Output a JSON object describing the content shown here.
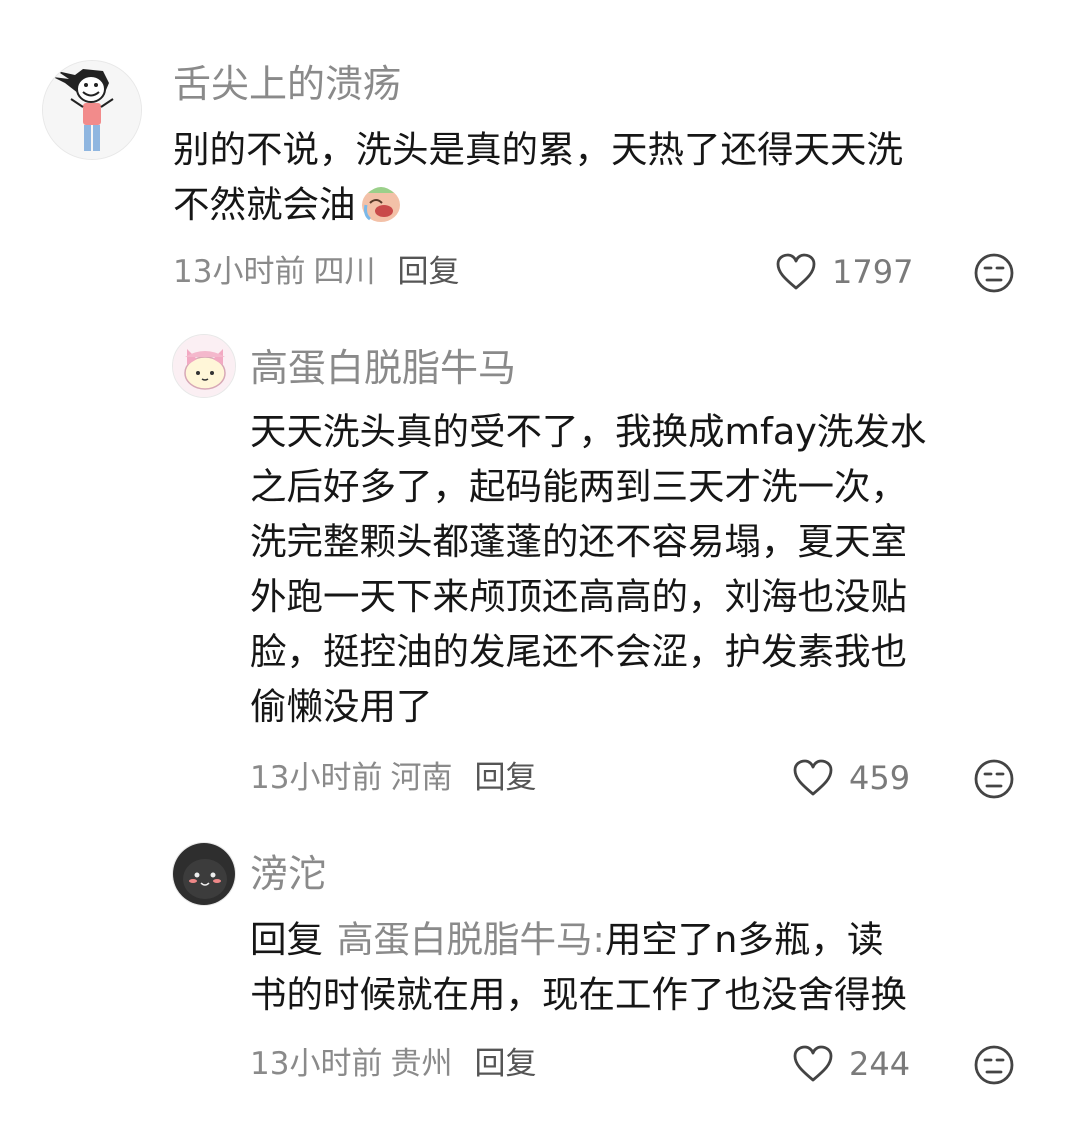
{
  "comments": [
    {
      "username": "舌尖上的溃疡",
      "lines": [
        "别的不说，洗头是真的累，天热了还得天天洗",
        "不然就会油"
      ],
      "time": "13小时前",
      "location": "四川",
      "reply_label": "回复",
      "likes": "1797"
    },
    {
      "username": "高蛋白脱脂牛马",
      "lines": [
        "天天洗头真的受不了，我换成mfay洗发水",
        "之后好多了，起码能两到三天才洗一次，",
        "洗完整颗头都蓬蓬的还不容易塌，夏天室",
        "外跑一天下来颅顶还高高的，刘海也没贴",
        "脸，挺控油的发尾还不会涩，护发素我也",
        "偷懒没用了"
      ],
      "time": "13小时前",
      "location": "河南",
      "reply_label": "回复",
      "likes": "459"
    },
    {
      "username": "滂沱",
      "reply_prefix": "回复",
      "reply_target": "高蛋白脱脂牛马:",
      "first_line_rest": "用空了n多瓶，读",
      "lines": [
        "书的时候就在用，现在工作了也没舍得换"
      ],
      "time": "13小时前",
      "location": "贵州",
      "reply_label": "回复",
      "likes": "244"
    }
  ]
}
